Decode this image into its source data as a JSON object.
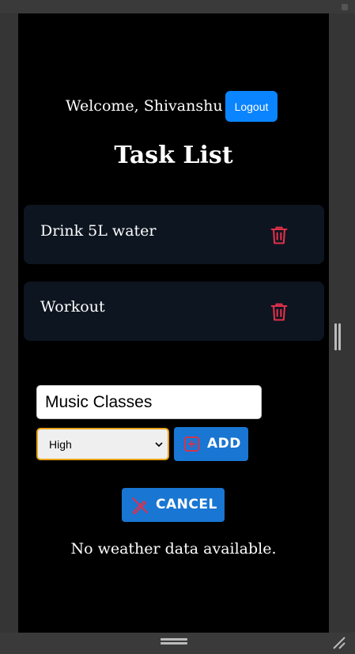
{
  "header": {
    "welcome": "Welcome, Shivanshu !",
    "logout_label": "Logout"
  },
  "title": "Task List",
  "tasks": [
    {
      "name": "Drink 5L water",
      "delete_icon": "trash-icon"
    },
    {
      "name": "Workout",
      "delete_icon": "trash-icon"
    }
  ],
  "form": {
    "task_input_value": "Music Classes",
    "priority_selected": "High",
    "add_label": "ADD",
    "add_icon": "plus-square-icon",
    "cancel_label": "CANCEL",
    "cancel_icon": "cancel-edit-icon"
  },
  "weather": {
    "message": "No weather data available."
  },
  "colors": {
    "background": "#000000",
    "card": "#0d1520",
    "primary_button": "#1976d2",
    "logout_button": "#0a84ff",
    "danger_icon": "#e0304a",
    "select_focus": "#e8a317"
  }
}
